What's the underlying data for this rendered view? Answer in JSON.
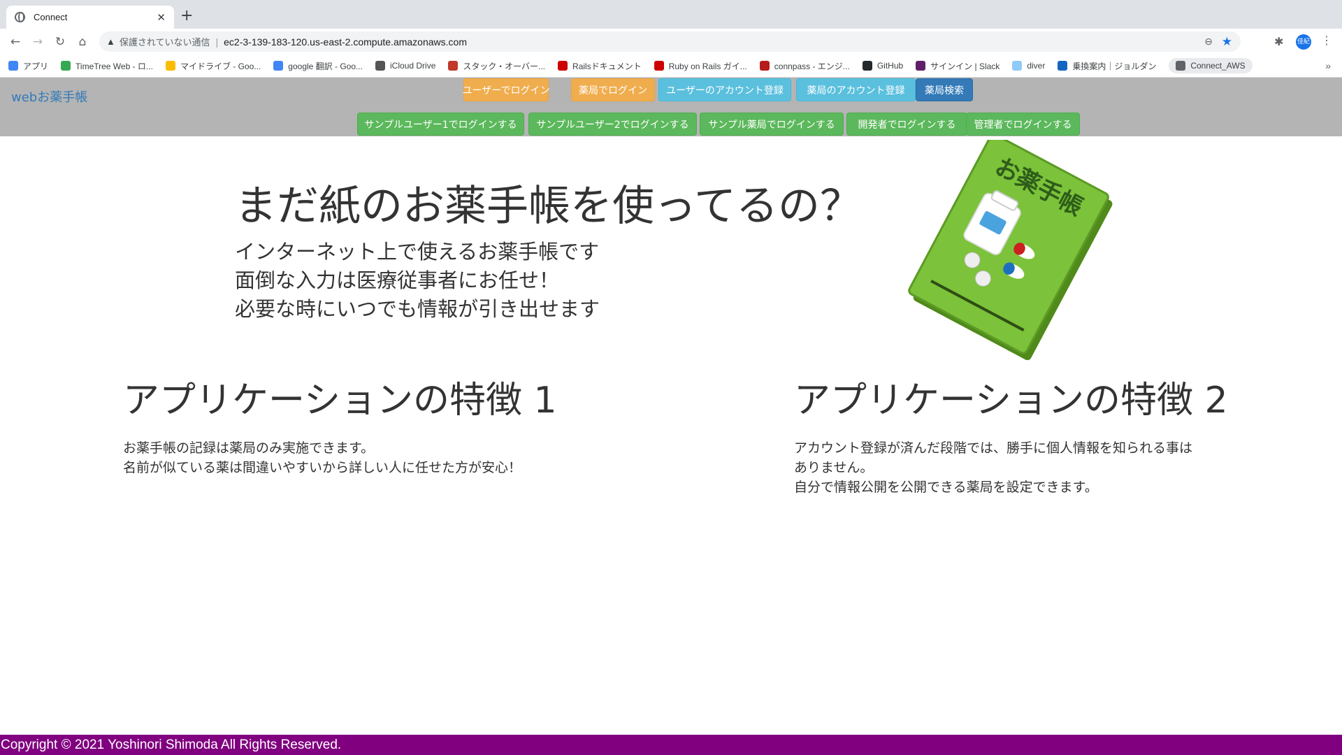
{
  "browser": {
    "tab_title": "Connect",
    "security_label": "保護されていない通信",
    "url": "ec2-3-139-183-120.us-east-2.compute.amazonaws.com",
    "profile_initials": "佳紀",
    "bookmarks": [
      {
        "label": "アプリ",
        "icon_color": "#4285f4"
      },
      {
        "label": "TimeTree Web - ロ...",
        "icon_color": "#34a853"
      },
      {
        "label": "マイドライブ - Goo...",
        "icon_color": "#fbbc04"
      },
      {
        "label": "google 翻訳 - Goo...",
        "icon_color": "#4285f4"
      },
      {
        "label": "iCloud Drive",
        "icon_color": "#555555"
      },
      {
        "label": "スタック・オーバー...",
        "icon_color": "#c0392b"
      },
      {
        "label": "Railsドキュメント",
        "icon_color": "#cc0000"
      },
      {
        "label": "Ruby on Rails ガイ...",
        "icon_color": "#cc0000"
      },
      {
        "label": "connpass - エンジ...",
        "icon_color": "#b71c1c"
      },
      {
        "label": "GitHub",
        "icon_color": "#24292e"
      },
      {
        "label": "サインイン | Slack",
        "icon_color": "#611f69"
      },
      {
        "label": "diver",
        "icon_color": "#90caf9"
      },
      {
        "label": "乗換案内｜ジョルダン",
        "icon_color": "#1565c0"
      },
      {
        "label": "Connect_AWS",
        "icon_color": "#5f6368"
      }
    ]
  },
  "navbar": {
    "brand": "webお薬手帳",
    "row1": [
      {
        "label": "ユーザーでログイン",
        "style": "warning"
      },
      {
        "label": "薬局でログイン",
        "style": "warning"
      },
      {
        "label": "ユーザーのアカウント登録",
        "style": "info"
      },
      {
        "label": "薬局のアカウント登録",
        "style": "info"
      },
      {
        "label": "薬局検索",
        "style": "primary"
      }
    ],
    "row2": [
      {
        "label": "サンプルユーザー1でログインする",
        "style": "success"
      },
      {
        "label": "サンプルユーザー2でログインする",
        "style": "success"
      },
      {
        "label": "サンプル薬局でログインする",
        "style": "success"
      },
      {
        "label": "開発者でログインする",
        "style": "success"
      },
      {
        "label": "管理者でログインする",
        "style": "success"
      }
    ]
  },
  "hero": {
    "title": "まだ紙のお薬手帳を使ってるの？",
    "lines": [
      "インターネット上で使えるお薬手帳です",
      "面倒な入力は医療従事者にお任せ！",
      "必要な時にいつでも情報が引き出せます"
    ],
    "book_label": "お薬手帳"
  },
  "features": [
    {
      "title": "アプリケーションの特徴 1",
      "lines": [
        "お薬手帳の記録は薬局のみ実施できます。",
        "名前が似ている薬は間違いやすいから詳しい人に任せた方が安心！"
      ]
    },
    {
      "title": "アプリケーションの特徴 2",
      "lines": [
        "アカウント登録が済んだ段階では、勝手に個人情報を知られる事は",
        "ありません。",
        "自分で情報公開を公開できる薬局を設定できます。"
      ]
    }
  ],
  "footer": {
    "copyright": "Copyright © 2021 Yoshinori Shimoda All Rights Reserved."
  }
}
